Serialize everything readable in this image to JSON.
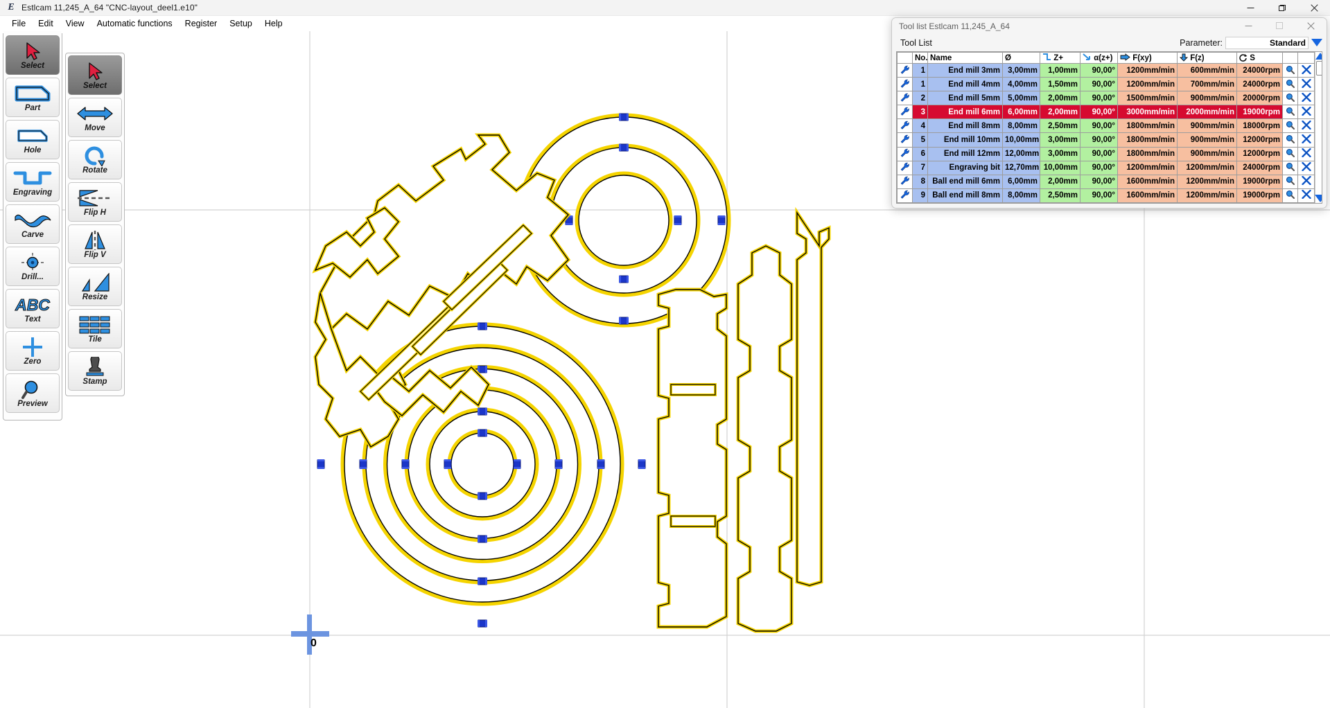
{
  "window": {
    "title": "Estlcam 11,245_A_64 \"CNC-layout_deel1.e10\"",
    "app_icon": "E",
    "minimize": "—",
    "maximize": "❐",
    "close": "✕"
  },
  "menubar": {
    "items": [
      {
        "label": "File"
      },
      {
        "label": "Edit"
      },
      {
        "label": "View"
      },
      {
        "label": "Automatic functions"
      },
      {
        "label": "Register"
      },
      {
        "label": "Setup"
      },
      {
        "label": "Help"
      }
    ]
  },
  "toolbar_primary": {
    "items": [
      {
        "label": "Select",
        "icon": "cursor-arrow-icon",
        "active": true
      },
      {
        "label": "Part",
        "icon": "part-outline-icon",
        "active": false
      },
      {
        "label": "Hole",
        "icon": "hole-outline-icon",
        "active": false
      },
      {
        "label": "Engraving",
        "icon": "engraving-icon",
        "active": false
      },
      {
        "label": "Carve",
        "icon": "carve-wave-icon",
        "active": false
      },
      {
        "label": "Drill...",
        "icon": "drill-target-icon",
        "active": false
      },
      {
        "label": "Text",
        "icon": "abc-text-icon",
        "active": false
      },
      {
        "label": "Zero",
        "icon": "zero-cross-icon",
        "active": false
      },
      {
        "label": "Preview",
        "icon": "preview-magnifier-icon",
        "active": false
      }
    ]
  },
  "toolbar_secondary": {
    "items": [
      {
        "label": "Select",
        "icon": "cursor-arrow-icon",
        "active": true
      },
      {
        "label": "Move",
        "icon": "move-arrows-icon",
        "active": false
      },
      {
        "label": "Rotate",
        "icon": "rotate-icon",
        "active": false
      },
      {
        "label": "Flip H",
        "icon": "flip-horizontal-icon",
        "active": false
      },
      {
        "label": "Flip V",
        "icon": "flip-vertical-icon",
        "active": false
      },
      {
        "label": "Resize",
        "icon": "resize-icon",
        "active": false
      },
      {
        "label": "Tile",
        "icon": "tile-grid-icon",
        "active": false
      },
      {
        "label": "Stamp",
        "icon": "stamp-icon",
        "active": false
      }
    ]
  },
  "canvas": {
    "origin_label": "0",
    "colors": {
      "outline": "#000000",
      "toolpath": "#f5d400",
      "tab_marker": "#1b36c8",
      "guide_line": "#d0d0d0",
      "background": "#ffffff"
    }
  },
  "tool_list_window": {
    "title": "Tool list Estlcam 11,245_A_64",
    "minimize": "—",
    "maximize": "❐",
    "close": "✕",
    "section_label": "Tool List",
    "parameter_label": "Parameter:",
    "parameter_value": "Standard",
    "columns": [
      {
        "key": "ico",
        "label": ""
      },
      {
        "key": "no",
        "label": "No."
      },
      {
        "key": "name",
        "label": "Name"
      },
      {
        "key": "dia",
        "label": "Ø"
      },
      {
        "key": "zp",
        "label": "Z+",
        "icon": "step-z-icon"
      },
      {
        "key": "ang",
        "label": "α(z+)",
        "icon": "plunge-angle-icon"
      },
      {
        "key": "fxy",
        "label": "F(xy)",
        "icon": "feed-xy-icon"
      },
      {
        "key": "fz",
        "label": "F(z)",
        "icon": "feed-z-icon"
      },
      {
        "key": "s",
        "label": "S",
        "icon": "spindle-speed-icon"
      },
      {
        "key": "mag",
        "label": ""
      },
      {
        "key": "del",
        "label": ""
      }
    ],
    "rows": [
      {
        "no": "1",
        "name": "End mill 3mm",
        "dia": "3,00mm",
        "zp": "1,00mm",
        "ang": "90,00°",
        "fxy": "1200mm/min",
        "fz": "600mm/min",
        "s": "24000rpm",
        "selected": false
      },
      {
        "no": "1",
        "name": "End mill 4mm",
        "dia": "4,00mm",
        "zp": "1,50mm",
        "ang": "90,00°",
        "fxy": "1200mm/min",
        "fz": "700mm/min",
        "s": "24000rpm",
        "selected": false
      },
      {
        "no": "2",
        "name": "End mill 5mm",
        "dia": "5,00mm",
        "zp": "2,00mm",
        "ang": "90,00°",
        "fxy": "1500mm/min",
        "fz": "900mm/min",
        "s": "20000rpm",
        "selected": false
      },
      {
        "no": "3",
        "name": "End mill 6mm",
        "dia": "6,00mm",
        "zp": "2,00mm",
        "ang": "90,00°",
        "fxy": "3000mm/min",
        "fz": "2000mm/min",
        "s": "19000rpm",
        "selected": true
      },
      {
        "no": "4",
        "name": "End mill 8mm",
        "dia": "8,00mm",
        "zp": "2,50mm",
        "ang": "90,00°",
        "fxy": "1800mm/min",
        "fz": "900mm/min",
        "s": "18000rpm",
        "selected": false
      },
      {
        "no": "5",
        "name": "End mill 10mm",
        "dia": "10,00mm",
        "zp": "3,00mm",
        "ang": "90,00°",
        "fxy": "1800mm/min",
        "fz": "900mm/min",
        "s": "12000rpm",
        "selected": false
      },
      {
        "no": "6",
        "name": "End mill 12mm",
        "dia": "12,00mm",
        "zp": "3,00mm",
        "ang": "90,00°",
        "fxy": "1800mm/min",
        "fz": "900mm/min",
        "s": "12000rpm",
        "selected": false
      },
      {
        "no": "7",
        "name": "Engraving bit",
        "dia": "12,70mm",
        "zp": "10,00mm",
        "ang": "90,00°",
        "fxy": "1200mm/min",
        "fz": "1200mm/min",
        "s": "24000rpm",
        "selected": false
      },
      {
        "no": "8",
        "name": "Ball end mill 6mm",
        "dia": "6,00mm",
        "zp": "2,00mm",
        "ang": "90,00°",
        "fxy": "1600mm/min",
        "fz": "1200mm/min",
        "s": "19000rpm",
        "selected": false
      },
      {
        "no": "9",
        "name": "Ball end mill 8mm",
        "dia": "8,00mm",
        "zp": "2,50mm",
        "ang": "90,00°",
        "fxy": "1600mm/min",
        "fz": "1200mm/min",
        "s": "19000rpm",
        "selected": false
      }
    ],
    "row_icons": {
      "edit": "wrench-icon",
      "inspect": "magnifier-icon",
      "delete": "delete-x-icon"
    },
    "colors": {
      "name_cell": "#a8c0f0",
      "depth_cell": "#b2f0a0",
      "feed_cell": "#f7bfa0",
      "selected_row": "#d60a30",
      "accent": "#1565e0"
    }
  }
}
